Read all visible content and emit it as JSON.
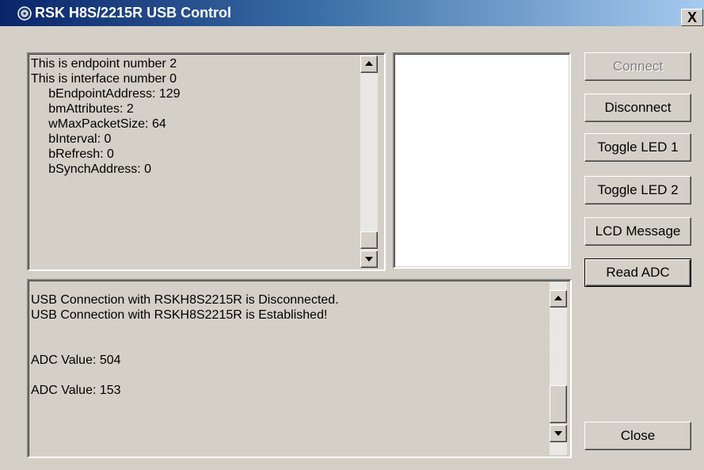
{
  "window": {
    "title": "RSK H8S/2215R USB Control",
    "close_glyph": "X"
  },
  "info_box": {
    "lines": [
      "This is endpoint number 2",
      "This is interface number 0",
      "     bEndpointAddress: 129",
      "     bmAttributes: 2",
      "     wMaxPacketSize: 64",
      "     bInterval: 0",
      "     bRefresh: 0",
      "     bSynchAddress: 0"
    ]
  },
  "log_box": {
    "lines": [
      "USB Connection with RSKH8S2215R is Disconnected.",
      "USB Connection with RSKH8S2215R is Established!",
      "",
      "",
      "ADC Value: 504",
      "",
      "ADC Value: 153"
    ]
  },
  "buttons": {
    "connect": "Connect",
    "disconnect": "Disconnect",
    "toggle_led_1": "Toggle LED 1",
    "toggle_led_2": "Toggle LED 2",
    "lcd_message": "LCD Message",
    "read_adc": "Read ADC",
    "close": "Close"
  },
  "icons": {
    "app": "usb-control-icon",
    "scroll_up": "scroll-up-arrow-icon",
    "scroll_down": "scroll-down-arrow-icon"
  },
  "colors": {
    "titlebar_start": "#0a246a",
    "titlebar_end": "#a6caf0",
    "face": "#d4d0c8",
    "field": "#ffffff",
    "disabled_text": "#808080"
  }
}
